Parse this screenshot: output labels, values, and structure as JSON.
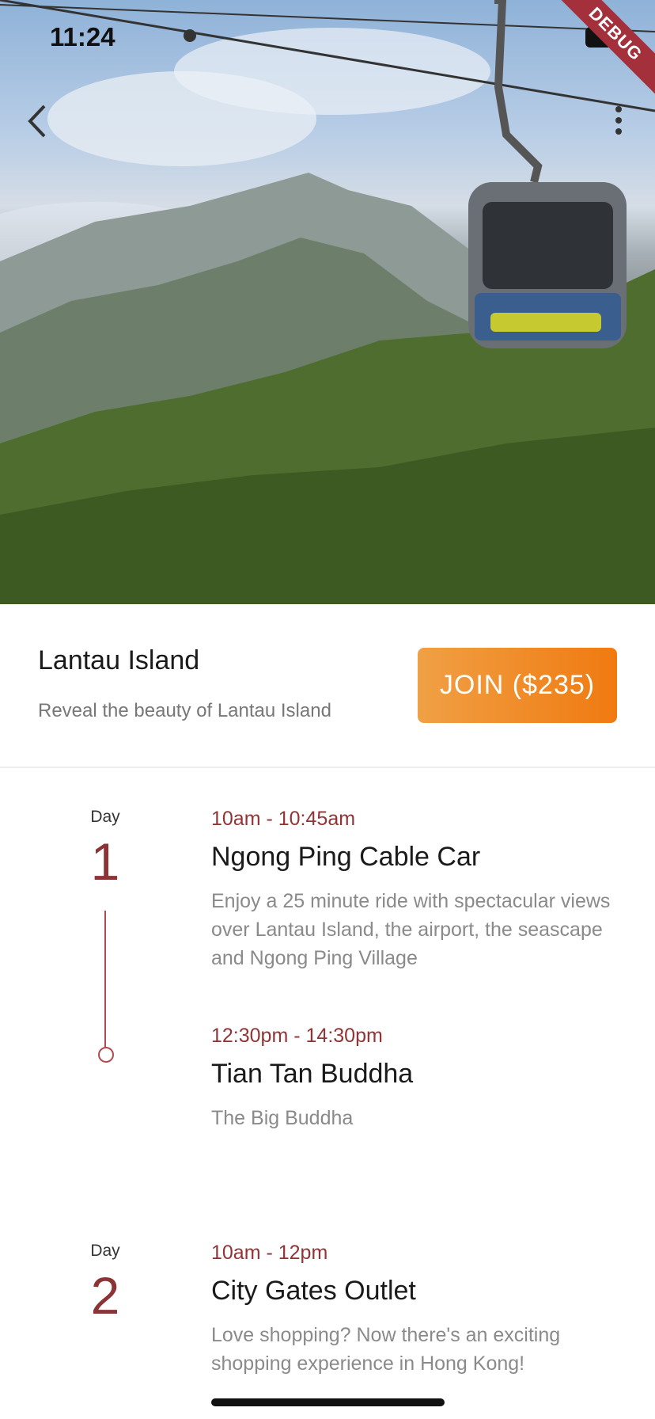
{
  "status_bar": {
    "time": "11:24"
  },
  "debug_banner": "DEBUG",
  "app_bar": {
    "back_icon": "chevron-left-icon",
    "menu_icon": "more-vertical-icon"
  },
  "tour": {
    "title": "Lantau Island",
    "subtitle": "Reveal the beauty of Lantau Island",
    "join_label": "JOIN ($235)"
  },
  "itinerary": [
    {
      "day_label": "Day",
      "day_number": "1",
      "events": [
        {
          "time": "10am - 10:45am",
          "title": "Ngong Ping Cable Car",
          "description": "Enjoy a 25 minute ride with spectacular views over Lantau Island, the airport, the seascape and Ngong Ping Village"
        },
        {
          "time": "12:30pm - 14:30pm",
          "title": "Tian Tan Buddha",
          "description": "The Big Buddha"
        }
      ]
    },
    {
      "day_label": "Day",
      "day_number": "2",
      "events": [
        {
          "time": "10am - 12pm",
          "title": "City Gates Outlet",
          "description": "Love shopping? Now there's an exciting shopping experience in Hong Kong!"
        }
      ]
    }
  ],
  "colors": {
    "accent": "#8b3335",
    "join_start": "#f0a045",
    "join_end": "#f07a10",
    "debug": "#a4303b"
  }
}
